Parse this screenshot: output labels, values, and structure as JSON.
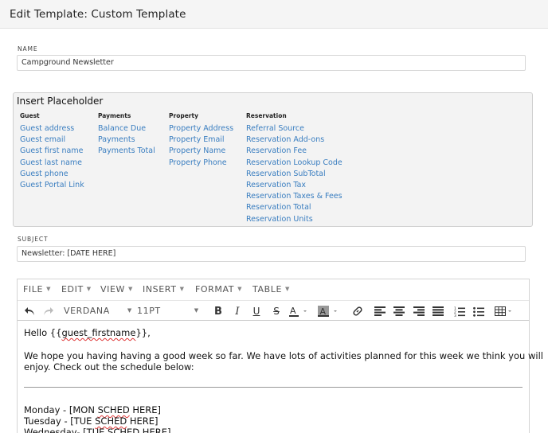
{
  "header": {
    "title": "Edit Template: Custom Template"
  },
  "name_field": {
    "label": "NAME",
    "value": "Campground Newsletter"
  },
  "placeholders": {
    "title": "Insert Placeholder",
    "columns": [
      {
        "heading": "Guest",
        "items": [
          "Guest address",
          "Guest email",
          "Guest first name",
          "Guest last name",
          "Guest phone",
          "Guest Portal Link"
        ]
      },
      {
        "heading": "Payments",
        "items": [
          "Balance Due",
          "Payments",
          "Payments Total"
        ]
      },
      {
        "heading": "Property",
        "items": [
          "Property Address",
          "Property Email",
          "Property Name",
          "Property Phone"
        ]
      },
      {
        "heading": "Reservation",
        "items": [
          "Referral Source",
          "Reservation Add-ons",
          "Reservation Fee",
          "Reservation Lookup Code",
          "Reservation SubTotal",
          "Reservation Tax",
          "Reservation Taxes & Fees",
          "Reservation Total",
          "Reservation Units"
        ]
      }
    ]
  },
  "subject_field": {
    "label": "SUBJECT",
    "value": "Newsletter: [DATE HERE]"
  },
  "editor": {
    "menus": [
      "FILE",
      "EDIT",
      "VIEW",
      "INSERT",
      "FORMAT",
      "TABLE"
    ],
    "font_family": "VERDANA",
    "font_size": "11PT",
    "icons": [
      "undo-icon",
      "redo-icon",
      "bold-icon",
      "italic-icon",
      "underline-icon",
      "strikethrough-icon",
      "text-color-icon",
      "highlight-color-icon",
      "link-icon",
      "align-left-icon",
      "align-center-icon",
      "align-right-icon",
      "align-justify-icon",
      "numbered-list-icon",
      "bullet-list-icon",
      "table-icon"
    ],
    "content": {
      "greeting_pre": "Hello {{",
      "greeting_var": "guest_firstname",
      "greeting_post": "}},",
      "para_line1": "We hope you having having a good week so far. We have lots of activities planned for this week we think you will",
      "para_line2": "enjoy. Check out the schedule below:",
      "mon_pre": "Monday - [MON ",
      "mon_word": "SCHED",
      "mon_post": " HERE]",
      "tue_pre": "Tuesday - [TUE ",
      "tue_word": "SCHED",
      "tue_post": " HERE]",
      "wed_pre": "Wednesday- [TUE ",
      "wed_word": "SCHED",
      "wed_post": " HERE]"
    }
  },
  "colors": {
    "link": "#3a7ec0",
    "spellcheck": "#dd3333"
  }
}
